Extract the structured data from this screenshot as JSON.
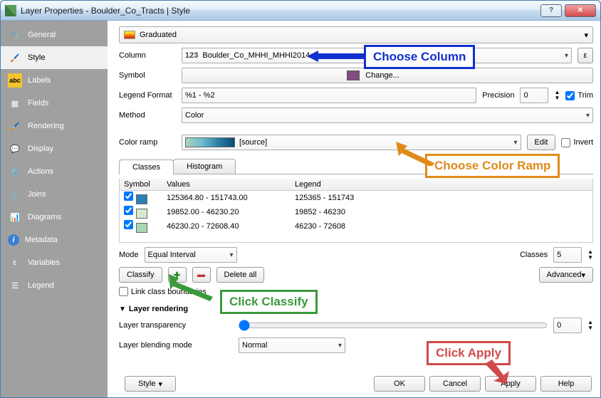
{
  "title": "Layer Properties - Boulder_Co_Tracts | Style",
  "sidebar": {
    "items": [
      {
        "label": "General"
      },
      {
        "label": "Style"
      },
      {
        "label": "Labels"
      },
      {
        "label": "Fields"
      },
      {
        "label": "Rendering"
      },
      {
        "label": "Display"
      },
      {
        "label": "Actions"
      },
      {
        "label": "Joins"
      },
      {
        "label": "Diagrams"
      },
      {
        "label": "Metadata"
      },
      {
        "label": "Variables"
      },
      {
        "label": "Legend"
      }
    ]
  },
  "style_type": "Graduated",
  "column": {
    "label": "Column",
    "type_badge": "123",
    "value": "Boulder_Co_MHHI_MHHI2014",
    "epsilon": "ε"
  },
  "symbol": {
    "label": "Symbol",
    "button": "Change..."
  },
  "legend_format": {
    "label": "Legend Format",
    "value": "%1 - %2",
    "precision_label": "Precision",
    "precision": "0",
    "trim_label": "Trim"
  },
  "method": {
    "label": "Method",
    "value": "Color"
  },
  "color_ramp": {
    "label": "Color ramp",
    "value": "[source]",
    "edit": "Edit",
    "invert_label": "Invert"
  },
  "tabs": {
    "classes": "Classes",
    "histogram": "Histogram"
  },
  "table": {
    "headers": [
      "Symbol",
      "Values",
      "Legend"
    ],
    "rows": [
      {
        "color": "#2b7fb8",
        "values": "125364.80 - 151743.00",
        "legend": "125365 - 151743"
      },
      {
        "color": "#d7ead1",
        "values": "19852.00 - 46230.20",
        "legend": "19852 - 46230"
      },
      {
        "color": "#a8d5b4",
        "values": "46230.20 - 72608.40",
        "legend": "46230 - 72608"
      }
    ]
  },
  "mode": {
    "label": "Mode",
    "value": "Equal Interval"
  },
  "classes_count": {
    "label": "Classes",
    "value": "5"
  },
  "buttons": {
    "classify": "Classify",
    "delete_all": "Delete all",
    "advanced": "Advanced"
  },
  "link_boundaries": "Link class boundaries",
  "layer_rendering": {
    "title": "Layer rendering",
    "transparency": "Layer transparency",
    "transparency_value": "0",
    "blending": "Layer blending mode",
    "blending_value": "Normal"
  },
  "bottom": {
    "style": "Style",
    "ok": "OK",
    "cancel": "Cancel",
    "apply": "Apply",
    "help": "Help"
  },
  "annotations": {
    "column": "Choose Column",
    "ramp": "Choose Color Ramp",
    "classify": "Click Classify",
    "apply": "Click Apply"
  }
}
